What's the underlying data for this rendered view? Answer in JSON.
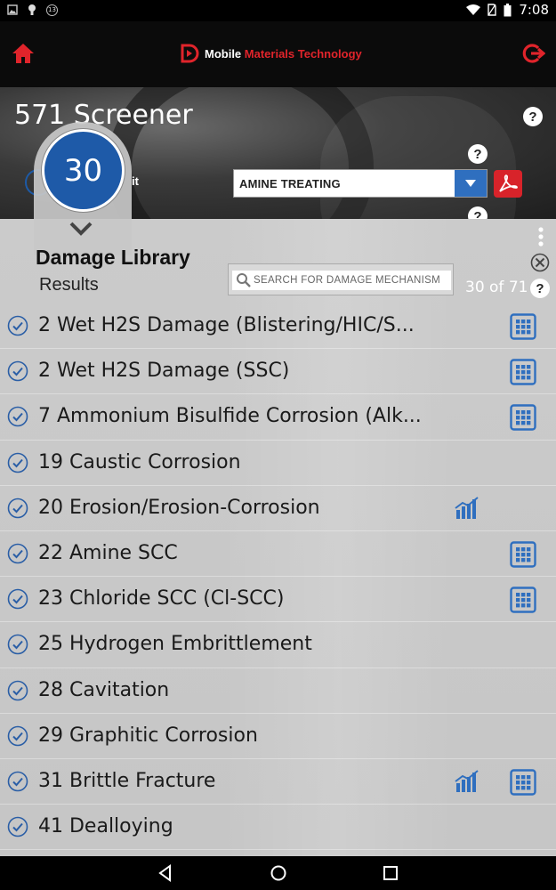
{
  "status_bar": {
    "time": "7:08",
    "badge": "13",
    "icons": [
      "image-icon",
      "android-icon",
      "notification-badge-icon",
      "wifi-icon",
      "no-sim-icon",
      "battery-icon"
    ]
  },
  "header": {
    "brand_prefix": "Mobile ",
    "brand_accent": "Materials Technology",
    "icons": [
      "home-icon",
      "brand-logo-icon",
      "logout-icon"
    ],
    "accent_color": "#e0242b"
  },
  "hero": {
    "title": "571 Screener",
    "partial_label": "it",
    "unit_select": {
      "value": "AMINE TREATING"
    },
    "help_label": "?"
  },
  "panel": {
    "count": "30",
    "title": "Damage Library",
    "subtitle": "Results",
    "search": {
      "placeholder": "SEARCH FOR DAMAGE MECHANISM"
    },
    "results_count": "30 of 71",
    "help_label": "?"
  },
  "results": [
    {
      "label": "2 Wet H2S Damage (Blistering/HIC/S...",
      "chart": false,
      "grid": true
    },
    {
      "label": "2 Wet H2S Damage (SSC)",
      "chart": false,
      "grid": true
    },
    {
      "label": "7 Ammonium Bisulfide Corrosion (Alk...",
      "chart": false,
      "grid": true
    },
    {
      "label": "19 Caustic Corrosion",
      "chart": false,
      "grid": false
    },
    {
      "label": "20 Erosion/Erosion-Corrosion",
      "chart": true,
      "grid": false
    },
    {
      "label": "22 Amine SCC",
      "chart": false,
      "grid": true
    },
    {
      "label": "23 Chloride SCC (Cl-SCC)",
      "chart": false,
      "grid": true
    },
    {
      "label": "25 Hydrogen Embrittlement",
      "chart": false,
      "grid": false
    },
    {
      "label": "28 Cavitation",
      "chart": false,
      "grid": false
    },
    {
      "label": "29 Graphitic Corrosion",
      "chart": false,
      "grid": false
    },
    {
      "label": "31 Brittle Fracture",
      "chart": true,
      "grid": true
    },
    {
      "label": "41 Dealloying",
      "chart": false,
      "grid": false
    }
  ],
  "colors": {
    "accent_blue": "#1e5aa8",
    "icon_blue": "#2f6fbf",
    "pdf_red": "#d8232a"
  }
}
